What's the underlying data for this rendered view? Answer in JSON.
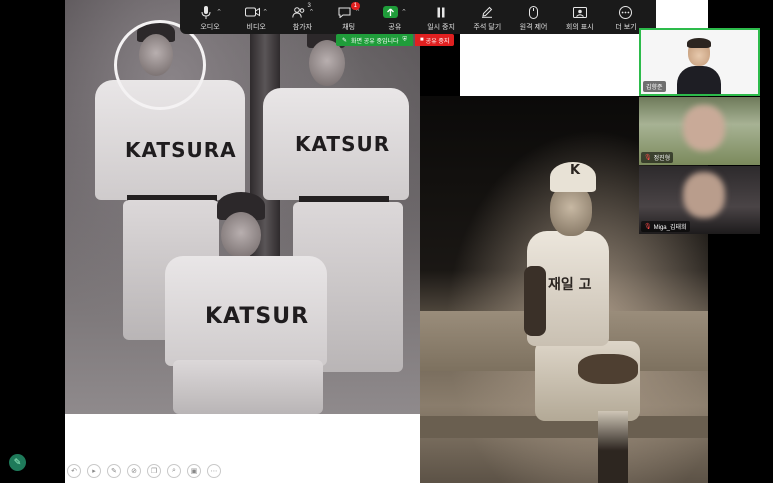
{
  "toolbar": {
    "items": [
      {
        "label": "오디오",
        "icon": "microphone-icon",
        "has_caret": true
      },
      {
        "label": "비디오",
        "icon": "video-camera-icon",
        "has_caret": true
      },
      {
        "label": "참가자",
        "icon": "participants-icon",
        "count": "3",
        "has_caret": true
      },
      {
        "label": "채팅",
        "icon": "chat-icon",
        "badge": "1",
        "has_caret": true
      },
      {
        "label": "공유",
        "icon": "share-screen-icon",
        "has_caret": true
      },
      {
        "label": "일시 중지",
        "icon": "pause-icon",
        "has_caret": false
      },
      {
        "label": "주석 달기",
        "icon": "annotate-pen-icon",
        "has_caret": false
      },
      {
        "label": "원격 제어",
        "icon": "remote-control-mouse-icon",
        "has_caret": false
      },
      {
        "label": "회의 표시",
        "icon": "show-meeting-icon",
        "has_caret": false
      },
      {
        "label": "더 보기",
        "icon": "more-icon",
        "has_caret": false
      }
    ]
  },
  "share_banner": {
    "status": "화면 공유 중입니다",
    "stop_label": "공유 중지"
  },
  "left_photo": {
    "jersey_texts": [
      "KATSURA",
      "KATSUR",
      "KATSUR"
    ]
  },
  "right_photo": {
    "cap_letter": "K",
    "jersey_text": "재일 고"
  },
  "participants": [
    {
      "name": "김향준",
      "muted": false
    },
    {
      "name": "정진형",
      "muted": true
    },
    {
      "name": "Miga_김태희",
      "muted": true
    }
  ],
  "colors": {
    "toolbar_bg": "#1a1a1a",
    "share_green": "#1f9d3a",
    "stop_red": "#e02020",
    "active_speaker_border": "#2dbb4b"
  }
}
